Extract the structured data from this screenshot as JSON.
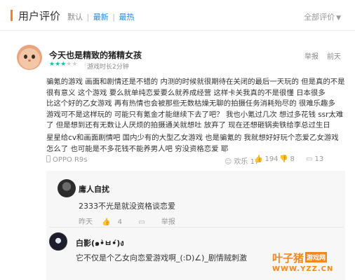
{
  "header": {
    "title": "用户评价",
    "sort_default": "默认",
    "sort_latest": "最新",
    "sort_hot": "最热",
    "separator": "|",
    "filter_label": "全部评价"
  },
  "review": {
    "user_name": "今天也是精致的猪精女孩",
    "rating": 3,
    "rating_max": 5,
    "game_time": "游戏时长2分钟",
    "report_label": "举报",
    "date": "前天",
    "body_lines": [
      "骗氪的游戏 画面和剧情还是不错的 内测的时候就很期待在关闭的最后一天玩的 但是真的不是",
      "很有意义 这个游戏 要么就单纯恋爱要么就养成经营 这样卡关我真的不是很懂 日本很多",
      "比这个好的乙女游戏 再有热情也会被那些无数枯燥无聊的拍摄任务消耗殆尽的 很难乐趣多",
      "游戏可不是这样玩的 可能只有氪金才能继续下去了吧？ 我也小氪过几次 想过多花钱 ssr太难",
      "了 但是想到还有无数让人厌烦的拍摄通关就想吐 放弃了 现在还想砸锅卖铁给李总过生日"
    ],
    "body_line2": "星星给cv和画面剧情吧 国内少有的大型乙女游戏 也是骗氪的 我就想好好玩个恋爱乙女游戏",
    "body_line3": "怎么了 也可能是不多花钱不能养男人吧 穷没资格恋爱 耶",
    "device": "OPPO R9s",
    "happy_label": "欢乐",
    "happy_count": "17",
    "like_count": "194",
    "dislike_count": "8",
    "comment_count": "13"
  },
  "replies": [
    {
      "name": "庸人自扰",
      "text": "2333不光是就没资格谈恋爱",
      "date": "昨天",
      "like_count": "4",
      "report_label": "举报"
    },
    {
      "name": "白影(๑•̀ㅂ•́)ง",
      "text": "它不仅是个乙女向恋爱游戏啊_(:D)∠)_剧情贼刺激"
    }
  ],
  "watermark": {
    "brand": "叶子猪",
    "tag": "游戏网",
    "url": "WWW.YZZ.CN"
  },
  "colors": {
    "accent_orange": "#ff7a2a",
    "link_blue": "#1e88e5",
    "star_teal": "#22b8a8",
    "watermark_orange": "#f08a1c"
  }
}
